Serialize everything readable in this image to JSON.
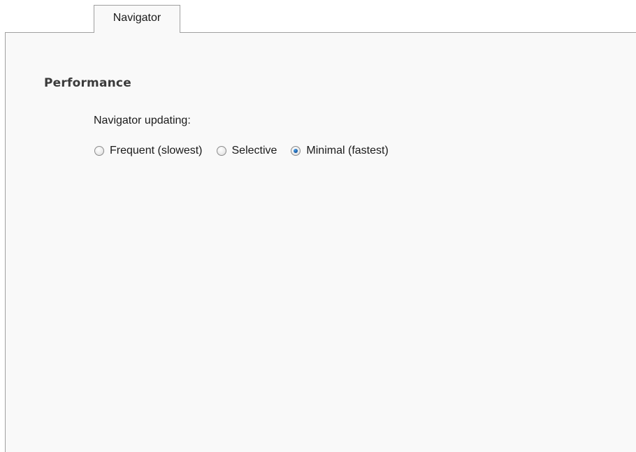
{
  "tabs": [
    {
      "label": "Navigator",
      "active": true
    }
  ],
  "performance": {
    "title": "Performance",
    "updating_label": "Navigator updating:",
    "options": [
      {
        "label": "Frequent (slowest)",
        "selected": false
      },
      {
        "label": "Selective",
        "selected": false
      },
      {
        "label": "Minimal (fastest)",
        "selected": true
      }
    ]
  },
  "colors": {
    "panel_background": "#f9f9f9",
    "border": "#a0a0a0",
    "radio_dot": "#1b5fa8"
  }
}
